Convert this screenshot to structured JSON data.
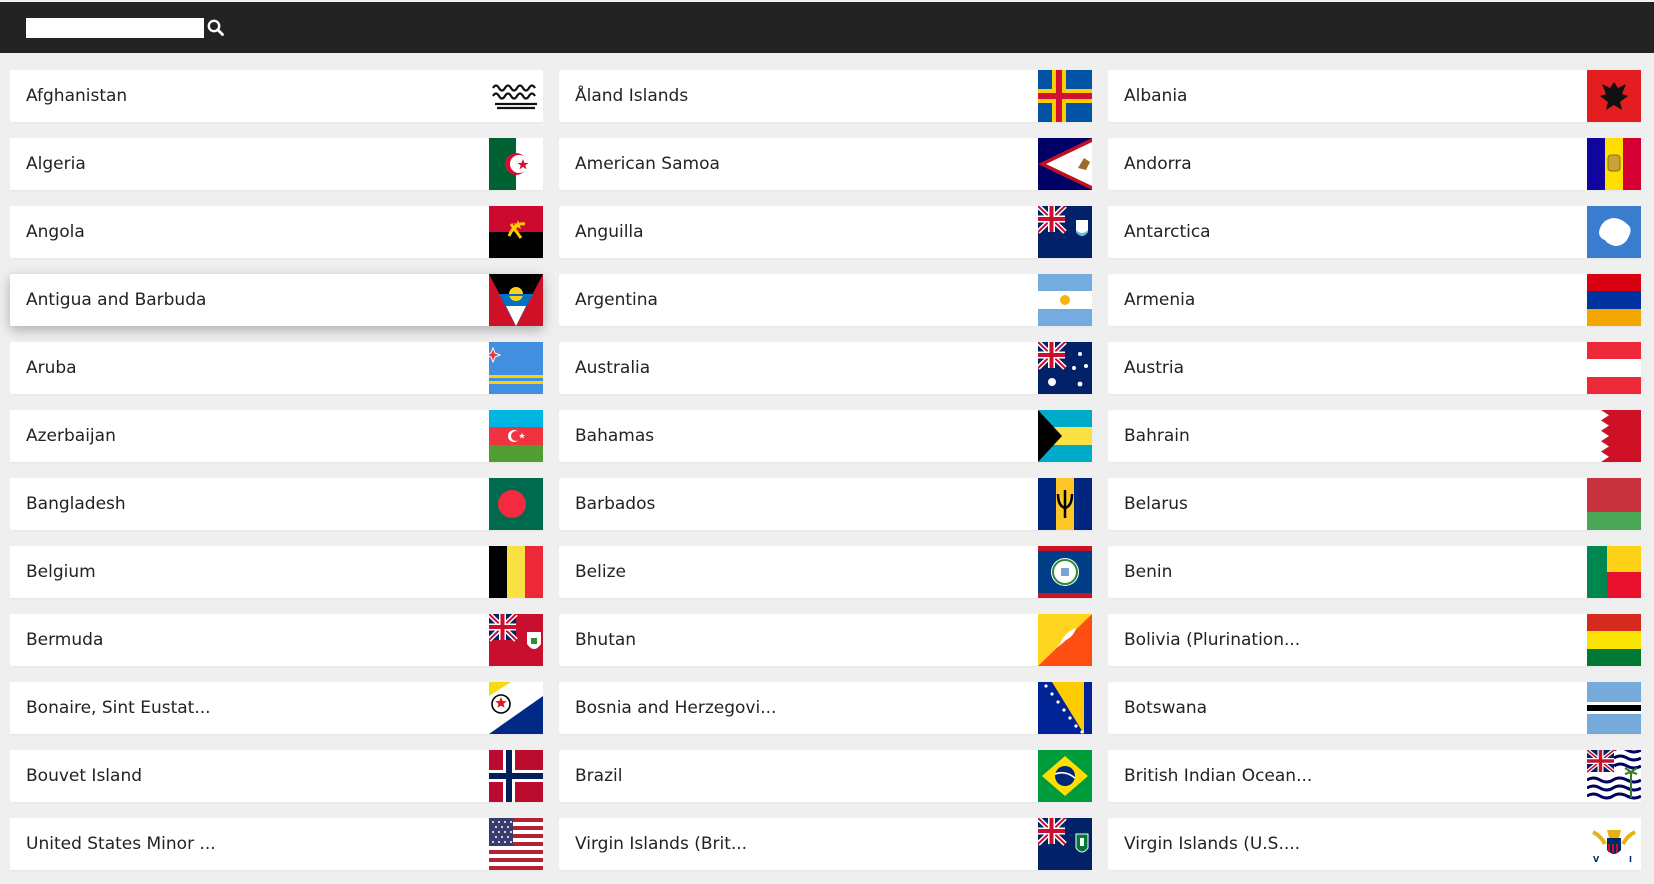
{
  "search": {
    "placeholder": ""
  },
  "countries": [
    {
      "name": "Afghanistan",
      "flag": "afghanistan-flag-icon"
    },
    {
      "name": "Åland Islands",
      "flag": "aland-islands-flag-icon"
    },
    {
      "name": "Albania",
      "flag": "albania-flag-icon"
    },
    {
      "name": "Algeria",
      "flag": "algeria-flag-icon"
    },
    {
      "name": "American Samoa",
      "flag": "american-samoa-flag-icon"
    },
    {
      "name": "Andorra",
      "flag": "andorra-flag-icon"
    },
    {
      "name": "Angola",
      "flag": "angola-flag-icon"
    },
    {
      "name": "Anguilla",
      "flag": "anguilla-flag-icon"
    },
    {
      "name": "Antarctica",
      "flag": "antarctica-flag-icon"
    },
    {
      "name": "Antigua and Barbuda",
      "flag": "antigua-and-barbuda-flag-icon"
    },
    {
      "name": "Argentina",
      "flag": "argentina-flag-icon"
    },
    {
      "name": "Armenia",
      "flag": "armenia-flag-icon"
    },
    {
      "name": "Aruba",
      "flag": "aruba-flag-icon"
    },
    {
      "name": "Australia",
      "flag": "australia-flag-icon"
    },
    {
      "name": "Austria",
      "flag": "austria-flag-icon"
    },
    {
      "name": "Azerbaijan",
      "flag": "azerbaijan-flag-icon"
    },
    {
      "name": "Bahamas",
      "flag": "bahamas-flag-icon"
    },
    {
      "name": "Bahrain",
      "flag": "bahrain-flag-icon"
    },
    {
      "name": "Bangladesh",
      "flag": "bangladesh-flag-icon"
    },
    {
      "name": "Barbados",
      "flag": "barbados-flag-icon"
    },
    {
      "name": "Belarus",
      "flag": "belarus-flag-icon"
    },
    {
      "name": "Belgium",
      "flag": "belgium-flag-icon"
    },
    {
      "name": "Belize",
      "flag": "belize-flag-icon"
    },
    {
      "name": "Benin",
      "flag": "benin-flag-icon"
    },
    {
      "name": "Bermuda",
      "flag": "bermuda-flag-icon"
    },
    {
      "name": "Bhutan",
      "flag": "bhutan-flag-icon"
    },
    {
      "name": "Bolivia (Plurination...",
      "flag": "bolivia-flag-icon"
    },
    {
      "name": "Bonaire, Sint Eustat...",
      "flag": "bonaire-flag-icon"
    },
    {
      "name": "Bosnia and Herzegovi...",
      "flag": "bosnia-flag-icon"
    },
    {
      "name": "Botswana",
      "flag": "botswana-flag-icon"
    },
    {
      "name": "Bouvet Island",
      "flag": "bouvet-island-flag-icon"
    },
    {
      "name": "Brazil",
      "flag": "brazil-flag-icon"
    },
    {
      "name": "British Indian Ocean...",
      "flag": "british-indian-ocean-flag-icon"
    },
    {
      "name": "United States Minor ...",
      "flag": "us-minor-islands-flag-icon"
    },
    {
      "name": "Virgin Islands (Brit...",
      "flag": "british-virgin-islands-flag-icon"
    },
    {
      "name": "Virgin Islands (U.S....",
      "flag": "us-virgin-islands-flag-icon"
    }
  ]
}
